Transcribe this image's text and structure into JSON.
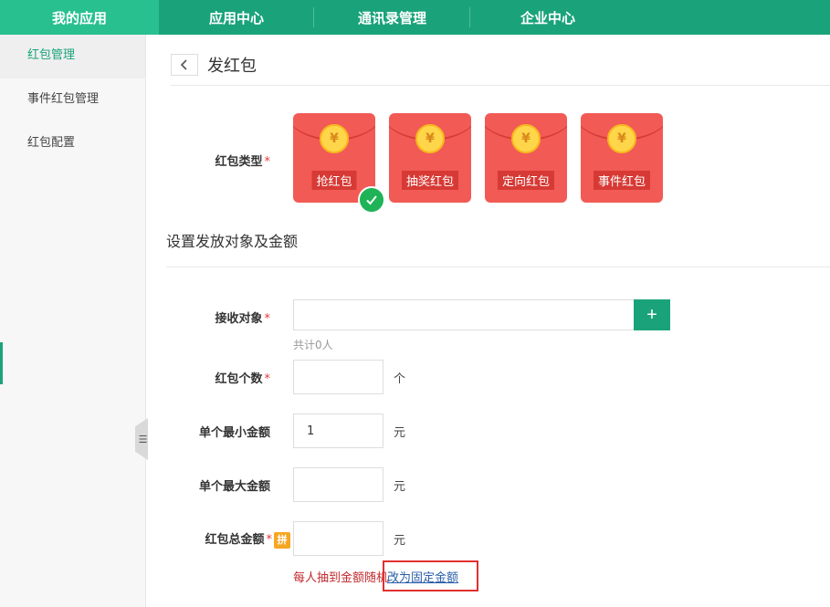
{
  "nav": {
    "tabs": [
      {
        "label": "我的应用"
      },
      {
        "label": "应用中心"
      },
      {
        "label": "通讯录管理"
      },
      {
        "label": "企业中心"
      }
    ]
  },
  "sidebar": {
    "items": [
      {
        "label": "红包管理"
      },
      {
        "label": "事件红包管理"
      },
      {
        "label": "红包配置"
      }
    ],
    "collapse_glyph": "☰"
  },
  "page": {
    "title": "发红包",
    "packet_type_label": "红包类型",
    "required_mark": "*",
    "packets": [
      {
        "name": "抢红包",
        "symbol": "¥",
        "selected": true
      },
      {
        "name": "抽奖红包",
        "symbol": "¥",
        "selected": false
      },
      {
        "name": "定向红包",
        "symbol": "¥",
        "selected": false
      },
      {
        "name": "事件红包",
        "symbol": "¥",
        "selected": false
      }
    ],
    "section_title": "设置发放对象及金额",
    "receiver_label": "接收对象",
    "receiver_value": "",
    "add_label": "+",
    "receiver_count": "共计0人",
    "count_label": "红包个数",
    "count_value": "",
    "count_unit": "个",
    "min_label": "单个最小金额",
    "min_value": "1",
    "min_unit": "元",
    "max_label": "单个最大金额",
    "max_value": "",
    "max_unit": "元",
    "total_label": "红包总金额",
    "total_badge": "拼",
    "total_value": "",
    "total_unit": "元",
    "note": "每人抽到金额随机",
    "switch_link": "改为固定金额"
  },
  "colors": {
    "nav_bg": "#1aa37a",
    "nav_active": "#28c08f",
    "packet": "#f25a55",
    "check": "#1fb357",
    "note": "#c1292e",
    "highlight": "#e03030"
  }
}
